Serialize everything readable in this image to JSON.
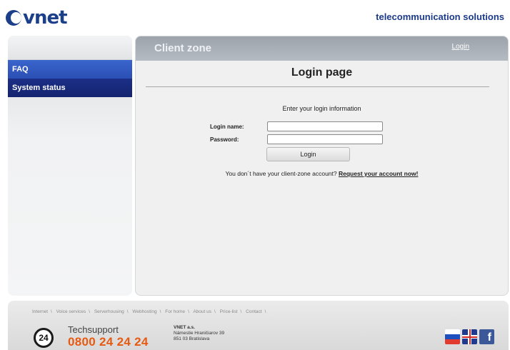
{
  "header": {
    "logo_text": "vnet",
    "tagline": "telecommunication solutions"
  },
  "sidebar": {
    "items": [
      {
        "label": "FAQ"
      },
      {
        "label": "System status"
      }
    ]
  },
  "main": {
    "zone_title": "Client zone",
    "login_link": "Login",
    "page_title": "Login page",
    "instruction": "Enter your login information",
    "login_name_label": "Login name:",
    "password_label": "Password:",
    "login_name_value": "",
    "password_value": "",
    "login_button": "Login",
    "no_account_text": "You don´t have your client-zone account?",
    "request_link": "Request your account now!"
  },
  "footer": {
    "links": [
      "Internet",
      "Voice services",
      "Serverhousing",
      "Webhosting",
      "For home",
      "About us",
      "Price-list",
      "Contact"
    ],
    "separator": "\\",
    "support_badge": "24",
    "support_label": "Techsupport",
    "support_phone": "0800 24 24 24",
    "company_name": "VNET a.s.",
    "company_street": "Námestie Hraničiarov 39",
    "company_city": "851 03 Bratislava"
  },
  "colors": {
    "brand_blue": "#1c3f8a",
    "faq_blue": "#3a65cc",
    "status_navy": "#1c2f86",
    "phone_orange": "#e65a12"
  }
}
